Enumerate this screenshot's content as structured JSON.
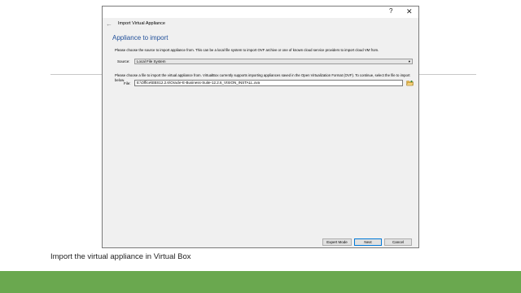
{
  "dialog": {
    "window_title": "Import Virtual Appliance",
    "help_label": "?",
    "close_label": "✕",
    "back_label": "←",
    "heading": "Appliance to import",
    "intro_text": "Please choose the source to import appliance from. This can be a local file system to import OVF archive or one of known cloud service providers to import cloud VM from.",
    "source": {
      "label": "Source:",
      "value": "Local File System",
      "dropdown_glyph": "▾"
    },
    "file_intro_text": "Please choose a file to import the virtual appliance from. VirtualBox currently supports importing appliances saved in the Open Virtualization Format (OVF). To continue, select the file to import below.",
    "file": {
      "label": "File:",
      "value": "E:\\Office\\EBS12.2.6\\Oracle-E-Business-Suite-12.2.6_VISION_INSTALL.ova",
      "icon": "folder-open-icon"
    },
    "buttons": {
      "expert": "Expert Mode",
      "next": "Next",
      "cancel": "Cancel"
    }
  },
  "caption": "Import the virtual appliance in Virtual Box",
  "colors": {
    "heading": "#1f4e99",
    "footer_bar": "#6aa84f",
    "default_button_border": "#0078d7"
  }
}
